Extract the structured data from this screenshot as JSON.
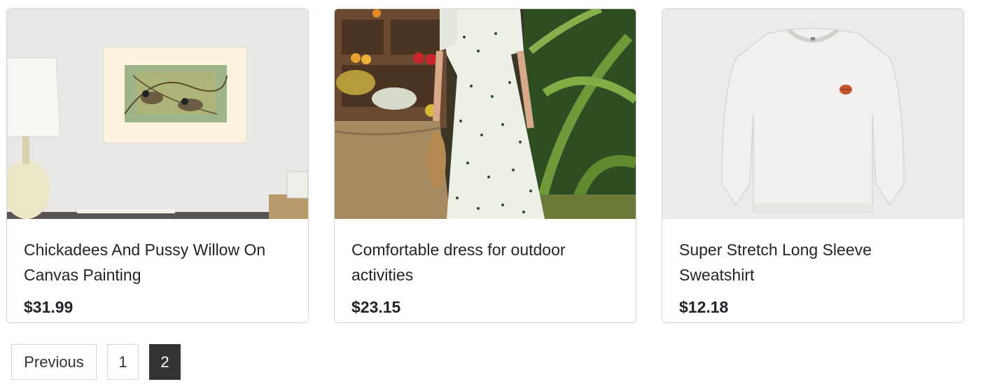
{
  "products": [
    {
      "title": "Chickadees And Pussy Willow On Canvas Painting",
      "price": "$31.99",
      "image_icon": "canvas-painting-image"
    },
    {
      "title": "Comfortable dress for outdoor activities",
      "price": "$23.15",
      "image_icon": "floral-dress-image"
    },
    {
      "title": "Super Stretch Long Sleeve Sweatshirt",
      "price": "$12.18",
      "image_icon": "sweatshirt-image"
    }
  ],
  "pagination": {
    "previous_label": "Previous",
    "pages": [
      "1",
      "2"
    ],
    "current_page": "2"
  },
  "colors": {
    "active_page_bg": "#343434",
    "border": "#d6d6d6",
    "text": "#212529"
  }
}
